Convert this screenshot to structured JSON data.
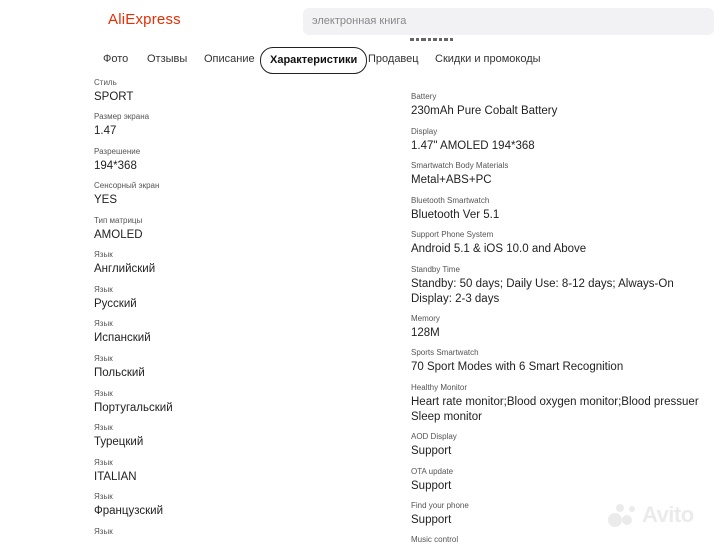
{
  "header": {
    "logo": "AliExpress",
    "search_placeholder": "электронная книга"
  },
  "tabs": [
    {
      "label": "Фото",
      "active": false
    },
    {
      "label": "Отзывы",
      "active": false
    },
    {
      "label": "Описание",
      "active": false
    },
    {
      "label": "Характеристики",
      "active": true
    },
    {
      "label": "Продавец",
      "active": false
    },
    {
      "label": "Скидки и промокоды",
      "active": false
    }
  ],
  "specs_left": [
    {
      "label": "Стиль",
      "value": "SPORT"
    },
    {
      "label": "Размер экрана",
      "value": "1.47"
    },
    {
      "label": "Разрешение",
      "value": "194*368"
    },
    {
      "label": "Сенсорный экран",
      "value": "YES"
    },
    {
      "label": "Тип матрицы",
      "value": "AMOLED"
    },
    {
      "label": "Язык",
      "value": "Английский"
    },
    {
      "label": "Язык",
      "value": "Русский"
    },
    {
      "label": "Язык",
      "value": "Испанский"
    },
    {
      "label": "Язык",
      "value": "Польский"
    },
    {
      "label": "Язык",
      "value": "Португальский"
    },
    {
      "label": "Язык",
      "value": "Турецкий"
    },
    {
      "label": "Язык",
      "value": "ITALIAN"
    },
    {
      "label": "Язык",
      "value": "Французский"
    },
    {
      "label": "Язык",
      "value": ""
    }
  ],
  "specs_right": [
    {
      "label": "Battery",
      "value": "230mAh Pure Cobalt Battery"
    },
    {
      "label": "Display",
      "value": "1.47\" AMOLED 194*368"
    },
    {
      "label": "Smartwatch Body Materials",
      "value": "Metal+ABS+PC"
    },
    {
      "label": "Bluetooth Smartwatch",
      "value": "Bluetooth Ver 5.1"
    },
    {
      "label": "Support Phone System",
      "value": "Android 5.1 & iOS 10.0 and Above"
    },
    {
      "label": "Standby Time",
      "value": "Standby: 50 days; Daily Use: 8-12 days; Always-On Display: 2-3 days"
    },
    {
      "label": "Memory",
      "value": "128M"
    },
    {
      "label": "Sports Smartwatch",
      "value": "70 Sport Modes with 6 Smart Recognition"
    },
    {
      "label": "Healthy Monitor",
      "value": "Heart rate monitor;Blood oxygen monitor;Blood pressuer Sleep monitor"
    },
    {
      "label": "AOD Display",
      "value": "Support"
    },
    {
      "label": "OTA update",
      "value": "Support"
    },
    {
      "label": "Find your phone",
      "value": "Support"
    },
    {
      "label": "Music control",
      "value": ""
    }
  ],
  "watermark": "Avito"
}
